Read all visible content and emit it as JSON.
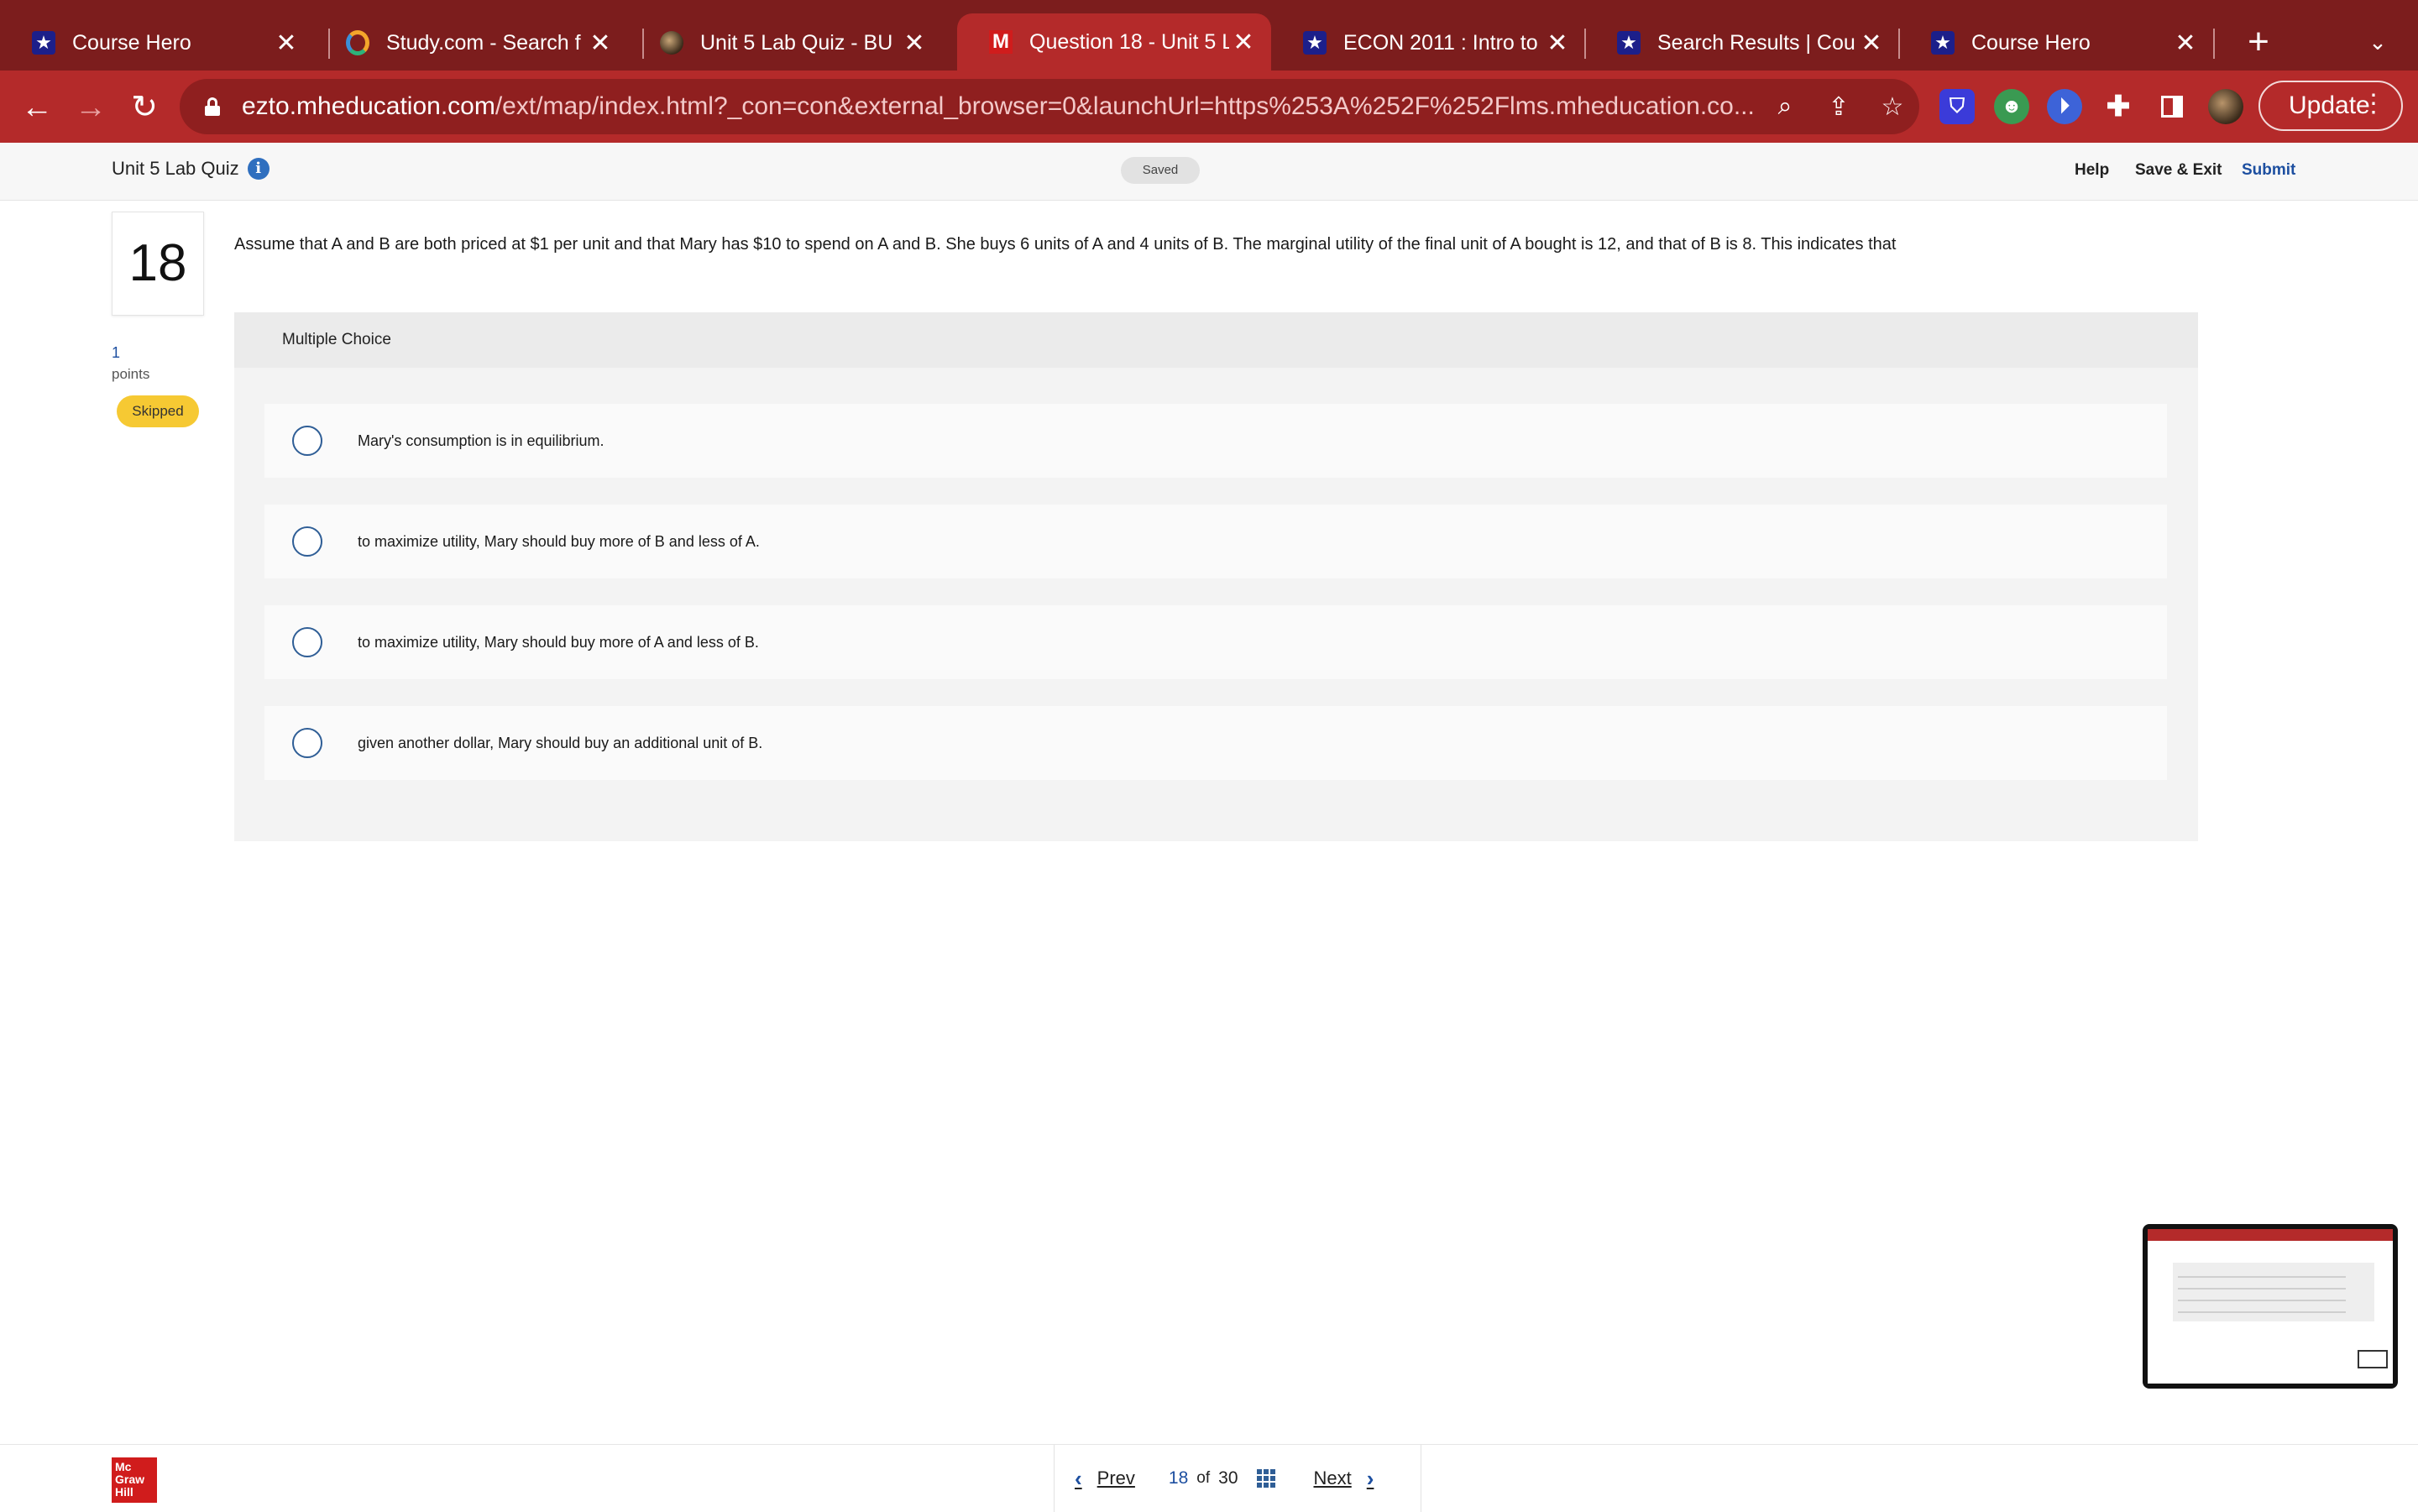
{
  "browser": {
    "tabs": [
      {
        "title": "Course Hero",
        "favicon": "star-icon",
        "active": false
      },
      {
        "title": "Study.com - Search f",
        "favicon": "ring-icon",
        "active": false
      },
      {
        "title": "Unit 5 Lab Quiz - BU",
        "favicon": "avatar-icon",
        "active": false
      },
      {
        "title": "Question 18 - Unit 5 L",
        "favicon": "m-icon",
        "active": true
      },
      {
        "title": "ECON 2011 : Intro to",
        "favicon": "star-icon",
        "active": false
      },
      {
        "title": "Search Results | Cou",
        "favicon": "star-icon",
        "active": false
      },
      {
        "title": "Course Hero",
        "favicon": "star-icon",
        "active": false
      }
    ],
    "url_host": "ezto.mheducation.com",
    "url_path": "/ext/map/index.html?_con=con&external_browser=0&launchUrl=https%253A%252F%252Flms.mheducation.co...",
    "update_label": "Update",
    "colors": {
      "tab_strip": "#7c1d1d",
      "toolbar": "#b42a2a"
    }
  },
  "header": {
    "quiz_title": "Unit 5 Lab Quiz",
    "saved_label": "Saved",
    "help_label": "Help",
    "save_exit_label": "Save & Exit",
    "submit_label": "Submit"
  },
  "question": {
    "number": "18",
    "points_value": "1",
    "points_label": "points",
    "status_badge": "Skipped",
    "text": "Assume that A and B are both priced at $1 per unit and that Mary has $10 to spend on A and B. She buys 6 units of A and 4 units of B. The marginal utility of the final unit of A bought is 12, and that of B is 8. This indicates that",
    "type_label": "Multiple Choice",
    "options": [
      "Mary's consumption is in equilibrium.",
      "to maximize utility, Mary should buy more of B and less of A.",
      "to maximize utility, Mary should buy more of A and less of B.",
      "given another dollar, Mary should buy an additional unit of B."
    ]
  },
  "footer": {
    "logo_text": "Mc Graw Hill",
    "prev_label": "Prev",
    "current_page": "18",
    "of_label": "of",
    "total_pages": "30",
    "next_label": "Next"
  }
}
